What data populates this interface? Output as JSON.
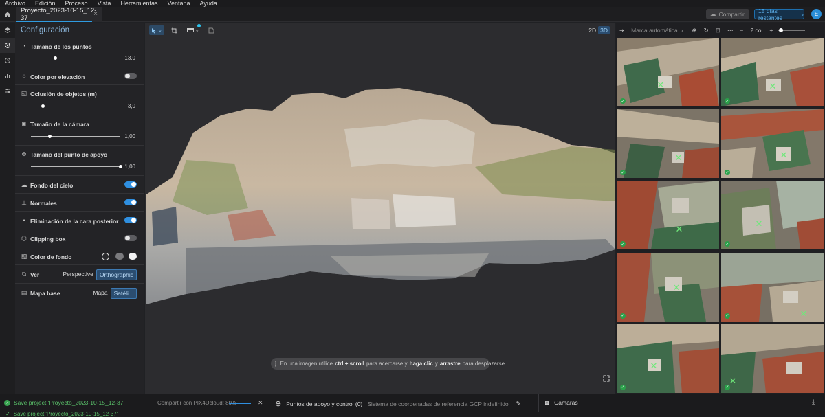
{
  "menu": [
    "Archivo",
    "Edición",
    "Proceso",
    "Vista",
    "Herramientas",
    "Ventana",
    "Ayuda"
  ],
  "tab": {
    "title": "Proyecto_2023-10-15_12-37",
    "close": "×"
  },
  "header": {
    "share_label": "Compartir",
    "trial_label": "15 días restantes",
    "avatar_initial": "E"
  },
  "panel": {
    "title": "Configuración",
    "point_size": {
      "label": "Tamaño de los puntos",
      "value": "13,0",
      "level": 0.25
    },
    "color_by_elevation": {
      "label": "Color por elevación",
      "on": false
    },
    "occlusion": {
      "label": "Oclusión de objetos (m)",
      "value": "3,0",
      "level": 0.13
    },
    "camera_size": {
      "label": "Tamaño de la cámara",
      "value": "1,00",
      "level": 0.2
    },
    "gcp_size": {
      "label": "Tamaño del punto de apoyo",
      "value": "1,00",
      "level": 1.0
    },
    "sky_background": {
      "label": "Fondo del cielo",
      "on": true
    },
    "normals": {
      "label": "Normales",
      "on": true
    },
    "backface_culling": {
      "label": "Eliminación de la cara posterior",
      "on": true
    },
    "clipping_box": {
      "label": "Clipping box",
      "on": false
    },
    "background_color": {
      "label": "Color de fondo"
    },
    "view": {
      "label": "Ver",
      "options": [
        "Perspective",
        "Orthographic"
      ],
      "selected": "Orthographic"
    },
    "basemap": {
      "label": "Mapa base",
      "options": [
        "Mapa",
        "Satéli..."
      ],
      "selected": "Satéli..."
    }
  },
  "viewport": {
    "dim_options": [
      "2D",
      "3D"
    ],
    "dim_selected": "3D",
    "hint_prefix": "En una imagen utilice",
    "hint_key1": "ctrl + scroll",
    "hint_mid1": "para acercarse y",
    "hint_key2": "haga clic",
    "hint_mid2": "y",
    "hint_key3": "arrastre",
    "hint_suffix": "para desplazarse"
  },
  "images_panel": {
    "mode_label": "Marca automática",
    "columns_label": "2 col",
    "thumb_count": 10
  },
  "status": {
    "save_message": "Save project 'Proyecto_2023-10-15_12-37'",
    "sync_message": "Compartir con PIX4Dcloud: 89%",
    "sync_progress": 0.89,
    "gcp_label": "Puntos de apoyo y control (0)",
    "gcp_crs": "Sistema de coordenadas de referencia GCP indefinido",
    "cameras_label": "Cámaras"
  },
  "colors": {
    "accent": "#2f8fe0",
    "success": "#3aa552",
    "panel": "#232326",
    "viewport": "#2c2c2f"
  }
}
